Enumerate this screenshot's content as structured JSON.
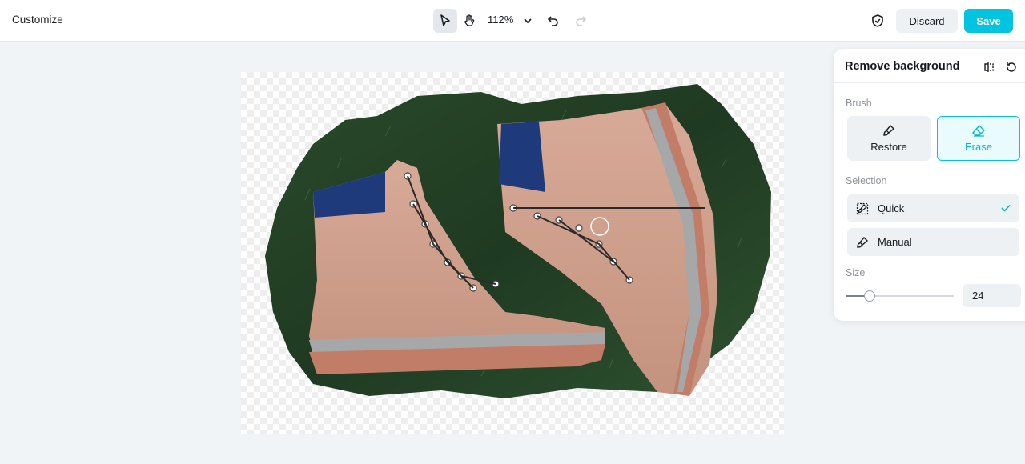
{
  "header": {
    "title": "Customize",
    "tools": {
      "select": "pointer-icon",
      "pan": "hand-icon"
    },
    "zoom": "112%",
    "discard_label": "Discard",
    "save_label": "Save"
  },
  "panel": {
    "title": "Remove background",
    "brush": {
      "label": "Brush",
      "options": [
        {
          "label": "Restore",
          "icon": "brush-icon",
          "selected": false
        },
        {
          "label": "Erase",
          "icon": "eraser-icon",
          "selected": true
        }
      ]
    },
    "selection": {
      "label": "Selection",
      "options": [
        {
          "label": "Quick",
          "icon": "quick-brush-icon",
          "selected": true
        },
        {
          "label": "Manual",
          "icon": "manual-brush-icon",
          "selected": false
        }
      ]
    },
    "size": {
      "label": "Size",
      "value": "24",
      "min": 0,
      "max": 100
    }
  },
  "colors": {
    "accent": "#00c4e0",
    "background": "#f1f4f6"
  }
}
